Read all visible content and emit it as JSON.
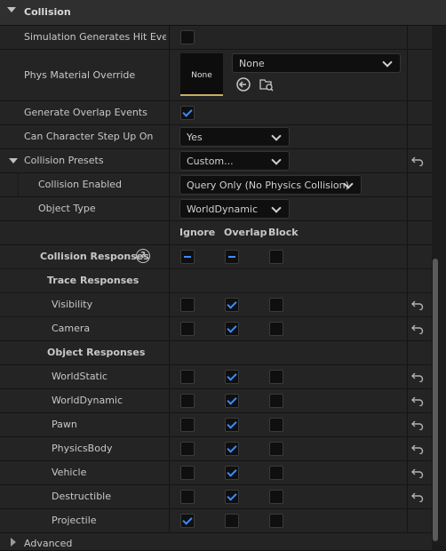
{
  "section": {
    "title": "Collision"
  },
  "rows": {
    "sim_hit_label": "Simulation Generates Hit Even...",
    "phys_mat_label": "Phys Material Override",
    "phys_mat_thumb": "None",
    "phys_mat_combo": "None",
    "overlap_label": "Generate Overlap Events",
    "step_up_label": "Can Character Step Up On",
    "step_up_value": "Yes",
    "presets_label": "Collision Presets",
    "presets_value": "Custom...",
    "enabled_label": "Collision Enabled",
    "enabled_value": "Query Only (No Physics Collision)",
    "object_type_label": "Object Type",
    "object_type_value": "WorldDynamic"
  },
  "columns": {
    "ignore": "Ignore",
    "overlap": "Overlap",
    "block": "Block"
  },
  "responses": {
    "label": "Collision Responses",
    "help": "?",
    "trace_label": "Trace Responses",
    "object_label": "Object Responses",
    "trace": [
      {
        "name": "Visibility",
        "ignore": false,
        "overlap": true,
        "block": false,
        "reset": true
      },
      {
        "name": "Camera",
        "ignore": false,
        "overlap": true,
        "block": false,
        "reset": true
      }
    ],
    "objects": [
      {
        "name": "WorldStatic",
        "ignore": false,
        "overlap": true,
        "block": false,
        "reset": true
      },
      {
        "name": "WorldDynamic",
        "ignore": false,
        "overlap": true,
        "block": false,
        "reset": true
      },
      {
        "name": "Pawn",
        "ignore": false,
        "overlap": true,
        "block": false,
        "reset": true
      },
      {
        "name": "PhysicsBody",
        "ignore": false,
        "overlap": true,
        "block": false,
        "reset": true
      },
      {
        "name": "Vehicle",
        "ignore": false,
        "overlap": true,
        "block": false,
        "reset": true
      },
      {
        "name": "Destructible",
        "ignore": false,
        "overlap": true,
        "block": false,
        "reset": true
      },
      {
        "name": "Projectile",
        "ignore": true,
        "overlap": false,
        "block": false,
        "reset": false
      }
    ]
  },
  "advanced_label": "Advanced",
  "colors": {
    "accent": "#3d8bff",
    "row_bg": "#242424",
    "panel_bg": "#1a1a1a"
  }
}
